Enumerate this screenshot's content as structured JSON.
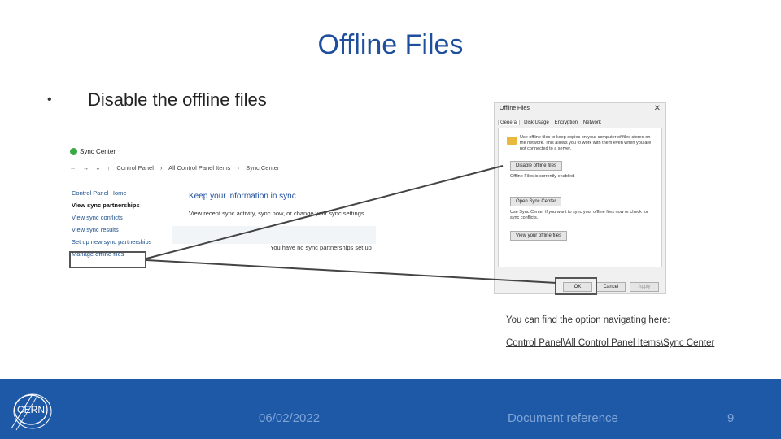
{
  "slide": {
    "title": "Offline Files",
    "bullet": "•",
    "bullet_text": "Disable the offline files"
  },
  "sync_center": {
    "window_title": "Sync Center",
    "address": [
      "←",
      "→",
      "⌄",
      "↑",
      "Control Panel",
      "›",
      "All Control Panel Items",
      "›",
      "Sync Center"
    ],
    "nav": [
      {
        "label": "Control Panel Home",
        "bold": false
      },
      {
        "label": "View sync partnerships",
        "bold": true
      },
      {
        "label": "View sync conflicts",
        "bold": false
      },
      {
        "label": "View sync results",
        "bold": false
      },
      {
        "label": "Set up new sync partnerships",
        "bold": false
      },
      {
        "label": "Manage offline files",
        "bold": false
      }
    ],
    "heading": "Keep your information in sync",
    "description": "View recent sync activity, sync now, or change your sync settings.",
    "empty_text": "You have no sync partnerships set up"
  },
  "offline_dialog": {
    "title": "Offline Files",
    "close": "✕",
    "tabs": [
      "General",
      "Disk Usage",
      "Encryption",
      "Network"
    ],
    "intro": "Use offline files to keep copies on your computer of files stored on the network. This allows you to work with them even when you are not connected to a server.",
    "disable_button": "Disable offline files",
    "status": "Offline Files is currently enabled.",
    "open_sync_button": "Open Sync Center",
    "sync_text": "Use Sync Center if you want to sync your offline files now or check for sync conflicts.",
    "view_files_button": "View your offline files",
    "ok": "OK",
    "cancel": "Cancel",
    "apply": "Apply"
  },
  "notes": {
    "hint": "You can find the option navigating here:",
    "path": "Control Panel\\All Control Panel Items\\Sync Center"
  },
  "footer": {
    "logo_text": "CERN",
    "date": "06/02/2022",
    "reference": "Document reference",
    "page": "9"
  },
  "colors": {
    "title": "#1f4e9c",
    "footer_bg": "#1e59a8",
    "footer_text": "#7fa4d6"
  }
}
